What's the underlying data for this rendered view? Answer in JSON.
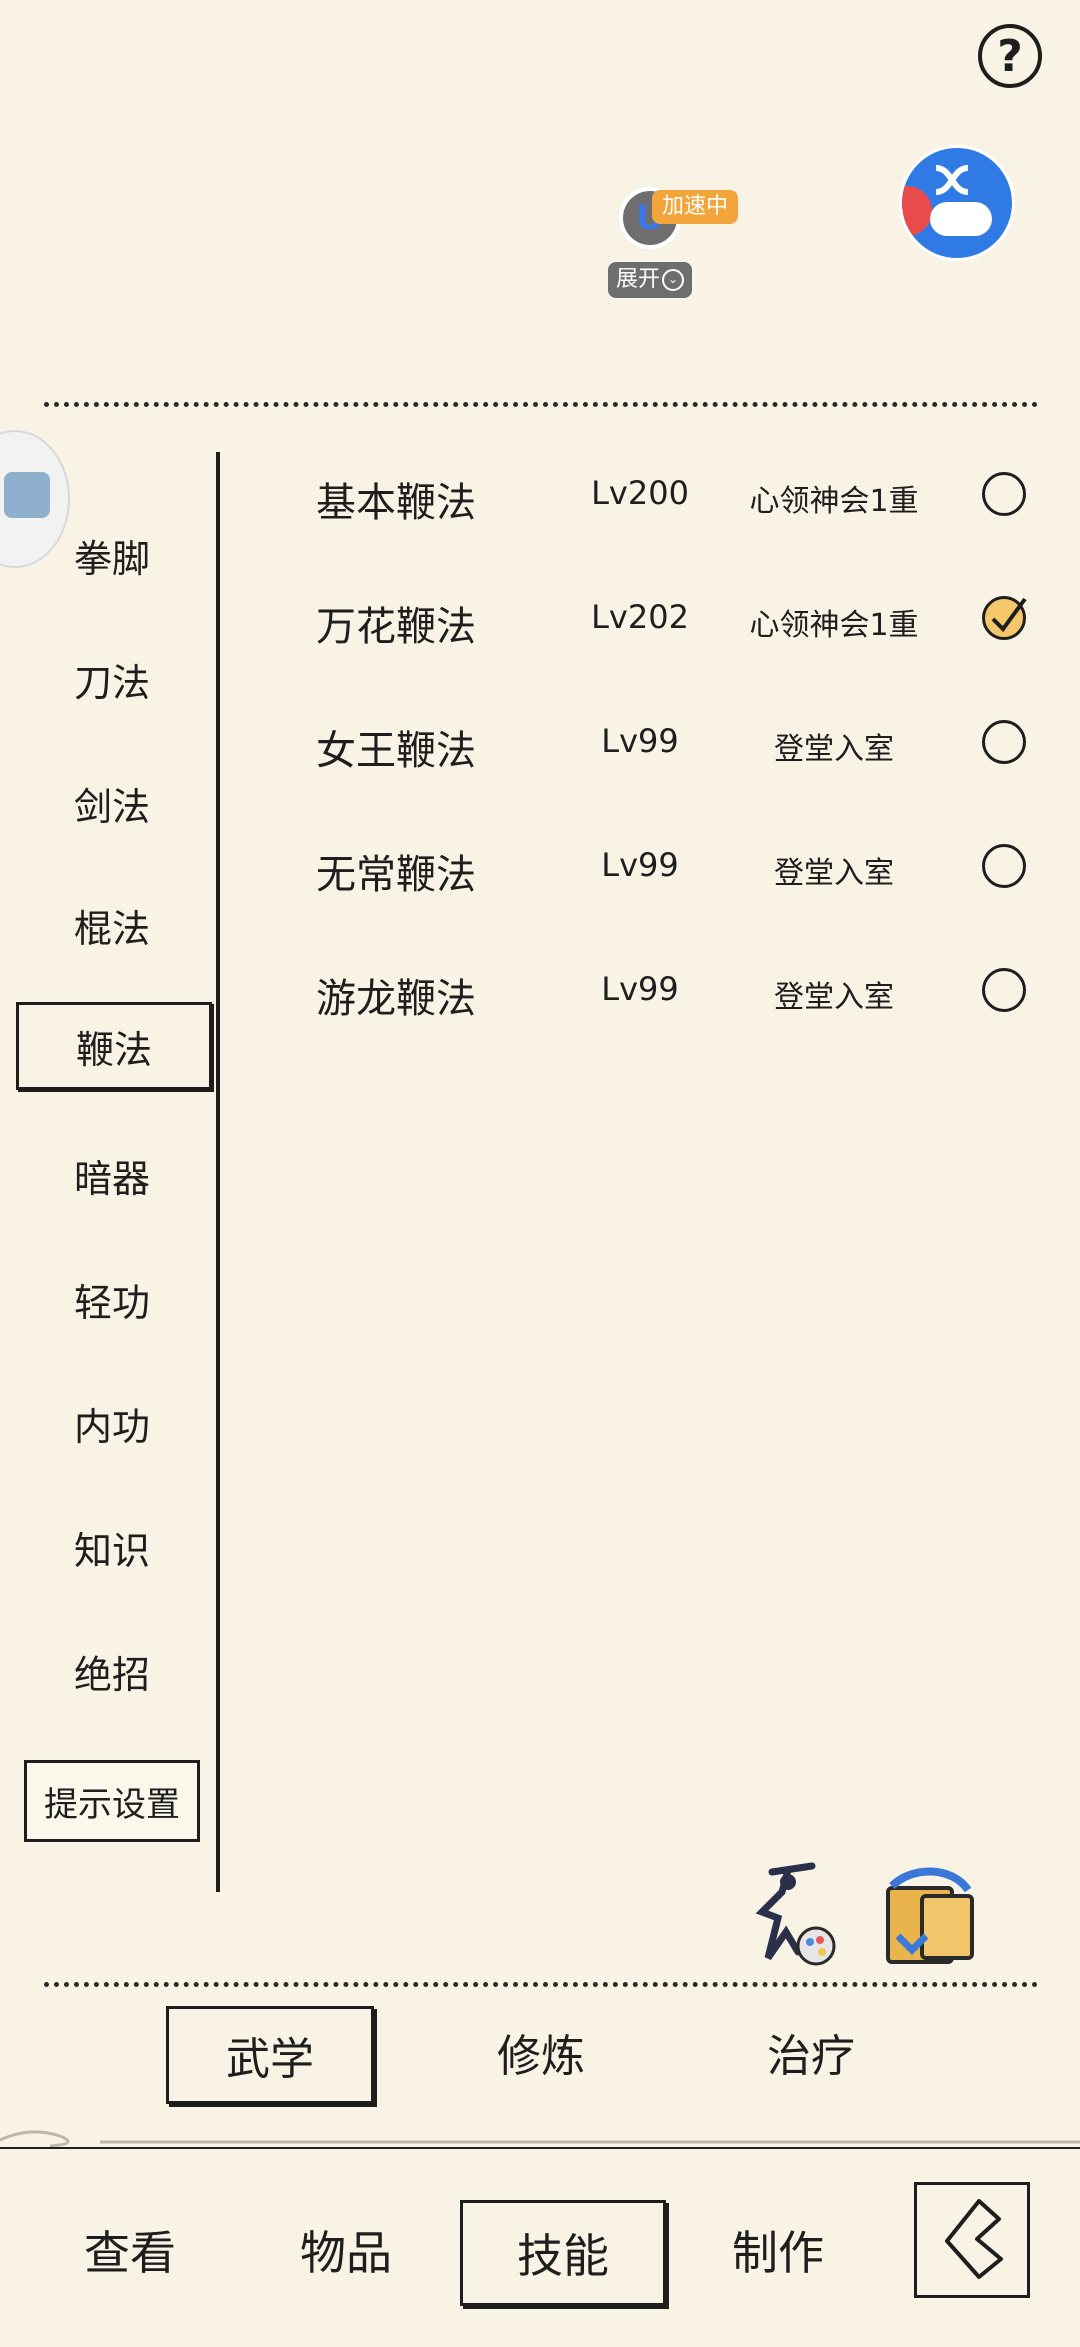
{
  "top": {
    "help_label": "?",
    "accel_tag": "加速中",
    "accel_badge_letter": "U",
    "expand_label": "展开"
  },
  "sidebar": {
    "items": [
      {
        "label": "拳脚"
      },
      {
        "label": "刀法"
      },
      {
        "label": "剑法"
      },
      {
        "label": "棍法"
      },
      {
        "label": "鞭法"
      },
      {
        "label": "暗器"
      },
      {
        "label": "轻功"
      },
      {
        "label": "内功"
      },
      {
        "label": "知识"
      },
      {
        "label": "绝招"
      }
    ],
    "active": "鞭法",
    "hint_settings": "提示设置"
  },
  "skills": [
    {
      "name": "基本鞭法",
      "level": "Lv200",
      "rank": "心领神会1重",
      "selected": false
    },
    {
      "name": "万花鞭法",
      "level": "Lv202",
      "rank": "心领神会1重",
      "selected": true
    },
    {
      "name": "女王鞭法",
      "level": "Lv99",
      "rank": "登堂入室",
      "selected": false
    },
    {
      "name": "无常鞭法",
      "level": "Lv99",
      "rank": "登堂入室",
      "selected": false
    },
    {
      "name": "游龙鞭法",
      "level": "Lv99",
      "rank": "登堂入室",
      "selected": false
    }
  ],
  "sub_tabs": [
    {
      "label": "武学",
      "active": true
    },
    {
      "label": "修炼",
      "active": false
    },
    {
      "label": "治疗",
      "active": false
    }
  ],
  "bottom_nav": [
    {
      "label": "查看",
      "active": false
    },
    {
      "label": "物品",
      "active": false
    },
    {
      "label": "技能",
      "active": true
    },
    {
      "label": "制作",
      "active": false
    }
  ],
  "colors": {
    "background": "#f8f3e4",
    "ink": "#1e1e1e",
    "accel_orange": "#f2a53a",
    "checked_fill": "#f4c86a"
  }
}
